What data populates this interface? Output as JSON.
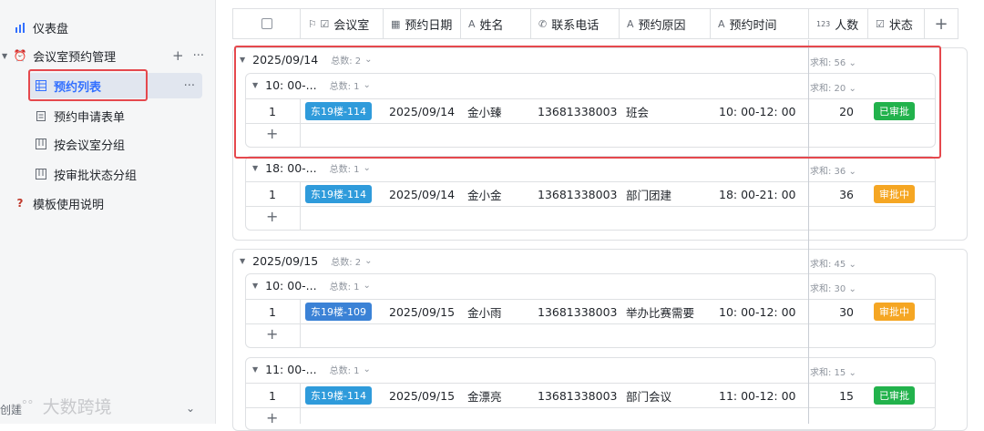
{
  "sidebar": {
    "items": [
      {
        "label": "仪表盘"
      },
      {
        "label": "会议室预约管理"
      },
      {
        "label": "预约列表"
      },
      {
        "label": "预约申请表单"
      },
      {
        "label": "按会议室分组"
      },
      {
        "label": "按审批状态分组"
      },
      {
        "label": "模板使用说明"
      }
    ],
    "footer_label": "创建",
    "watermark": "大数跨境"
  },
  "columns": [
    {
      "label": ""
    },
    {
      "label": "会议室"
    },
    {
      "label": "预约日期"
    },
    {
      "label": "姓名"
    },
    {
      "label": "联系电话"
    },
    {
      "label": "预约原因"
    },
    {
      "label": "预约时间"
    },
    {
      "label": "人数",
      "prefix": "123"
    },
    {
      "label": "状态"
    }
  ],
  "groups": [
    {
      "title": "2025/09/14",
      "count_label": "总数: 2",
      "sum_label": "求和: 56",
      "subgroups": [
        {
          "title": "10: 00-...",
          "count_label": "总数: 1",
          "sum_label": "求和: 20",
          "row": {
            "idx": "1",
            "room": "东19楼-114",
            "date": "2025/09/14",
            "name": "金小臻",
            "phone": "13681338003",
            "reason": "班会",
            "time": "10: 00-12: 00",
            "count": "20",
            "status": "已审批"
          }
        },
        {
          "title": "18: 00-...",
          "count_label": "总数: 1",
          "sum_label": "求和: 36",
          "row": {
            "idx": "1",
            "room": "东19楼-114",
            "date": "2025/09/14",
            "name": "金小金",
            "phone": "13681338003",
            "reason": "部门团建",
            "time": "18: 00-21: 00",
            "count": "36",
            "status": "审批中"
          }
        }
      ]
    },
    {
      "title": "2025/09/15",
      "count_label": "总数: 2",
      "sum_label": "求和: 45",
      "subgroups": [
        {
          "title": "10: 00-...",
          "count_label": "总数: 1",
          "sum_label": "求和: 30",
          "row": {
            "idx": "1",
            "room": "东19楼-109",
            "date": "2025/09/15",
            "name": "金小雨",
            "phone": "13681338003",
            "reason": "举办比赛需要",
            "time": "10: 00-12: 00",
            "count": "30",
            "status": "审批中"
          }
        },
        {
          "title": "11: 00-...",
          "count_label": "总数: 1",
          "sum_label": "求和: 15",
          "row": {
            "idx": "1",
            "room": "东19楼-114",
            "date": "2025/09/15",
            "name": "金漂亮",
            "phone": "13681338003",
            "reason": "部门会议",
            "time": "11: 00-12: 00",
            "count": "15",
            "status": "已审批"
          }
        }
      ]
    }
  ],
  "colors": {
    "tag_114": "#2f9bdb",
    "tag_109": "#3b82d6",
    "approved": "#22b24c",
    "pending": "#f5a623",
    "highlight": "#e5484d"
  }
}
